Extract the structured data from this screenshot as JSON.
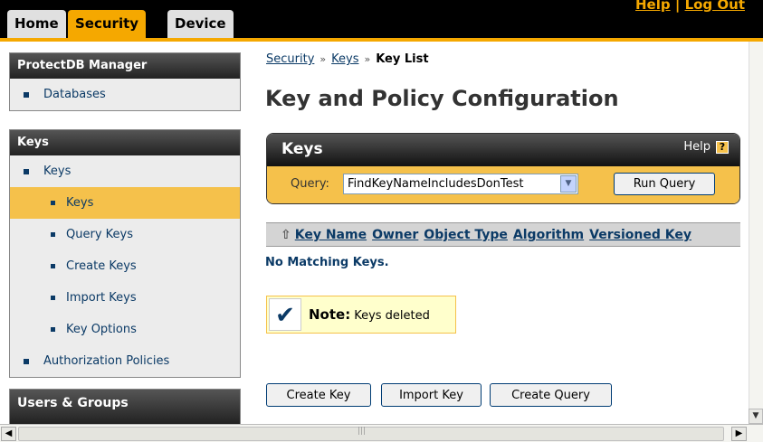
{
  "nav": {
    "tabs": [
      {
        "label": "Home"
      },
      {
        "label": "Security"
      },
      {
        "label": "Device"
      }
    ],
    "help_link": "Help",
    "separator": "|",
    "logout_link": "Log Out"
  },
  "sidebar": {
    "sections": [
      {
        "title": "ProtectDB Manager",
        "items": [
          {
            "label": "Databases"
          }
        ]
      },
      {
        "title": "Keys",
        "items": [
          {
            "label": "Keys"
          },
          {
            "label": "Keys"
          },
          {
            "label": "Query Keys"
          },
          {
            "label": "Create Keys"
          },
          {
            "label": "Import Keys"
          },
          {
            "label": "Key Options"
          },
          {
            "label": "Authorization Policies"
          }
        ]
      },
      {
        "title": "Users & Groups"
      }
    ]
  },
  "breadcrumb": {
    "items": [
      "Security",
      "Keys"
    ],
    "separator": "»",
    "current": "Key List"
  },
  "page_title": "Key and Policy Configuration",
  "keys_box": {
    "title": "Keys",
    "help_label": "Help",
    "help_icon_glyph": "?",
    "query_label": "Query:",
    "query_value": "FindKeyNameIncludesDonTest",
    "run_button": "Run Query"
  },
  "table": {
    "sort_glyph": "⇧",
    "columns": [
      "Key Name",
      "Owner",
      "Object Type",
      "Algorithm",
      "Versioned Key"
    ],
    "empty_message": "No Matching Keys."
  },
  "note": {
    "label": "Note:",
    "text": "Keys deleted",
    "icon": "checkmark-icon"
  },
  "buttons": {
    "create_key": "Create Key",
    "import_key": "Import Key",
    "create_query": "Create Query"
  },
  "colors": {
    "accent": "#f5a800",
    "highlight": "#f5c14b",
    "link": "#0b3a66"
  }
}
